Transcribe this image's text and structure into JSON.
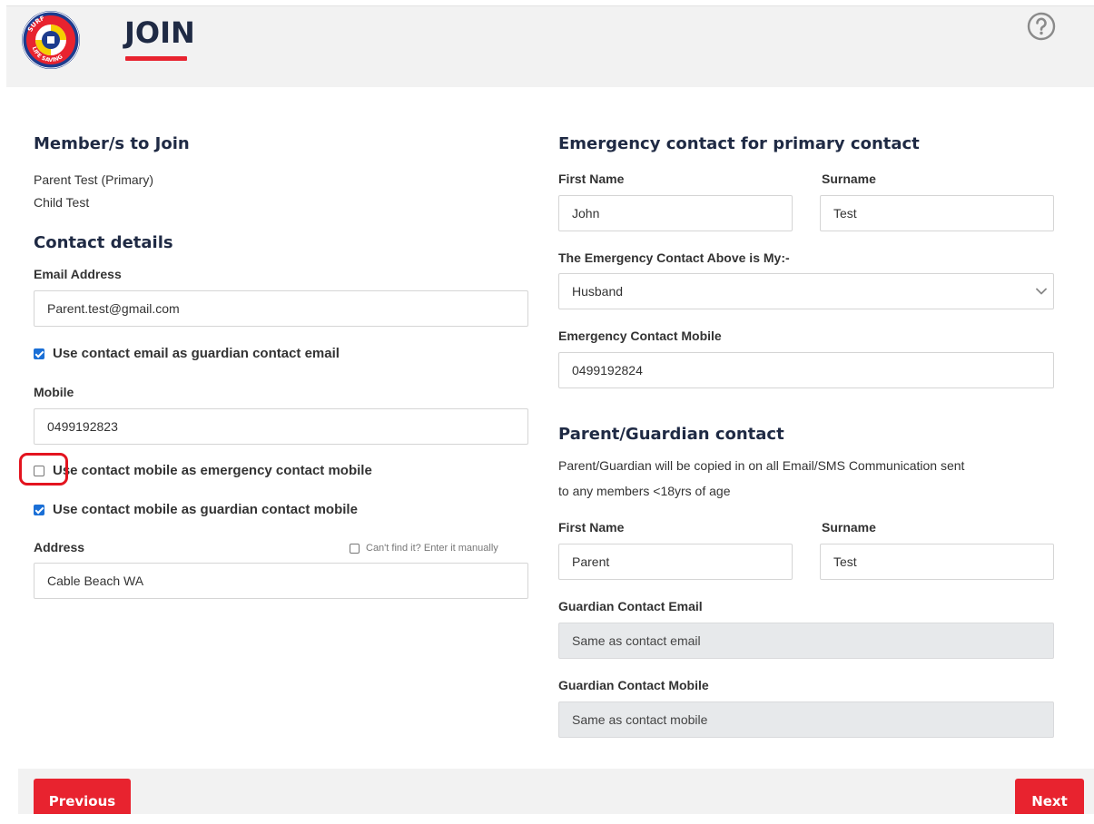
{
  "header": {
    "title": "JOIN",
    "logo_text": "SURF LIFE SAVING"
  },
  "members": {
    "heading": "Member/s to Join",
    "items": [
      "Parent Test (Primary)",
      "Child Test"
    ]
  },
  "contact": {
    "heading": "Contact details",
    "email_label": "Email Address",
    "email_value": "Parent.test@gmail.com",
    "email_guardian_check": "Use contact email as guardian contact email",
    "mobile_label": "Mobile",
    "mobile_value": "0499192823",
    "mobile_emergency_check": "Use contact mobile as emergency contact mobile",
    "mobile_guardian_check": "Use contact mobile as guardian contact mobile",
    "address_label": "Address",
    "address_manual": "Can't find it? Enter it manually",
    "address_value": "Cable Beach WA"
  },
  "emergency": {
    "heading": "Emergency contact for primary contact",
    "first_name_label": "First Name",
    "first_name_value": "John",
    "surname_label": "Surname",
    "surname_value": "Test",
    "relation_label": "The Emergency Contact Above is My:-",
    "relation_value": "Husband",
    "mobile_label": "Emergency Contact Mobile",
    "mobile_value": "0499192824"
  },
  "guardian": {
    "heading": "Parent/Guardian contact",
    "note_line1": "Parent/Guardian will be copied in on all Email/SMS Communication sent",
    "note_line2": "to any members <18yrs of age",
    "first_name_label": "First Name",
    "first_name_value": "Parent",
    "surname_label": "Surname",
    "surname_value": "Test",
    "email_label": "Guardian Contact Email",
    "email_value": "Same as contact email",
    "mobile_label": "Guardian Contact Mobile",
    "mobile_value": "Same as contact mobile"
  },
  "footer": {
    "previous": "Previous",
    "next": "Next"
  },
  "colors": {
    "accent_red": "#e8232f",
    "heading_navy": "#1f2a44",
    "checkbox_blue": "#1a6fd6"
  }
}
